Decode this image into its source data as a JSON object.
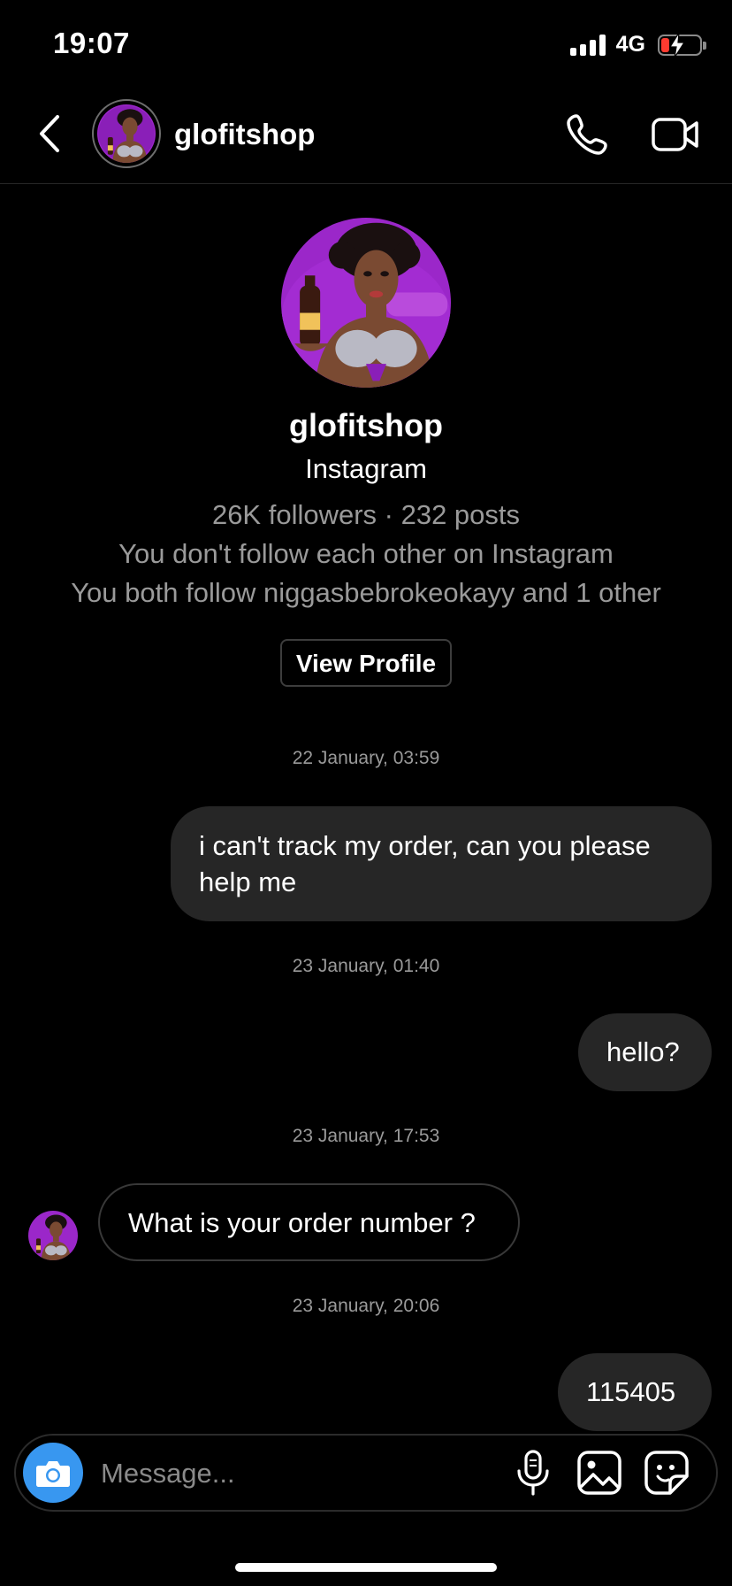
{
  "status_bar": {
    "time": "19:07",
    "network": "4G"
  },
  "header": {
    "username": "glofitshop"
  },
  "profile": {
    "username": "glofitshop",
    "platform": "Instagram",
    "stats": "26K followers · 232 posts",
    "follow_status": "You don't follow each other on Instagram",
    "mutual": "You both follow niggasbebrokeokayy and 1 other",
    "view_profile_label": "View Profile"
  },
  "messages": [
    {
      "timestamp": "22 January, 03:59",
      "direction": "out",
      "text": "i can't track my order, can you please help me"
    },
    {
      "timestamp": "23 January, 01:40",
      "direction": "out",
      "text": "hello?"
    },
    {
      "timestamp": "23 January, 17:53",
      "direction": "in",
      "text": "What is your order number ?"
    },
    {
      "timestamp": "23 January, 20:06",
      "direction": "out",
      "text": "115405"
    }
  ],
  "composer": {
    "placeholder": "Message..."
  },
  "icons": {
    "back": "chevron-left-icon",
    "call": "phone-icon",
    "video": "video-camera-icon",
    "camera": "camera-icon",
    "mic": "microphone-icon",
    "gallery": "image-icon",
    "sticker": "sticker-icon"
  },
  "colors": {
    "background": "#000000",
    "bubble_out": "#262626",
    "camera_button": "#3897f0",
    "secondary_text": "#9a9a9a",
    "avatar_bg": "#9b27c9"
  }
}
